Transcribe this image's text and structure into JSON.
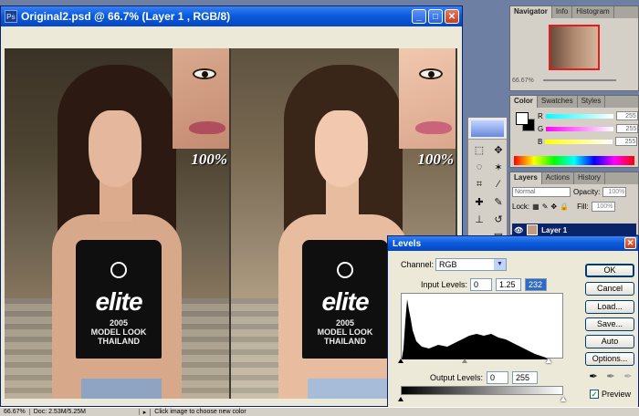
{
  "document": {
    "title": "Original2.psd @ 66.7% (Layer 1 , RGB/8)",
    "icon": "photoshop-doc-icon",
    "controls": [
      "minimize-icon",
      "maximize-icon",
      "close-icon"
    ],
    "photo_text": "elite",
    "photo_subtext": "2005\nMODEL LOOK\nTHAILAND",
    "zoom_inset_label": "100%"
  },
  "statusbar": {
    "zoom": "66.67%",
    "doc_size": "Doc: 2.53M/5.25M",
    "hint": "Click image to choose new color"
  },
  "navigator": {
    "tabs": [
      "Navigator",
      "Info",
      "Histogram"
    ],
    "zoom": "66.67%"
  },
  "color": {
    "tabs": [
      "Color",
      "Swatches",
      "Styles"
    ],
    "channels": [
      {
        "label": "R",
        "value": "255",
        "color": "#ff0000"
      },
      {
        "label": "G",
        "value": "255",
        "color": "#00c000"
      },
      {
        "label": "B",
        "value": "255",
        "color": "#0000ff"
      }
    ]
  },
  "layers": {
    "tabs": [
      "Layers",
      "Actions",
      "History"
    ],
    "blend_mode": "Normal",
    "opacity_label": "Opacity:",
    "opacity": "100%",
    "lock_label": "Lock:",
    "fill_label": "Fill:",
    "fill": "100%",
    "layer_name": "Layer 1"
  },
  "levels": {
    "title": "Levels",
    "channel_label": "Channel:",
    "channel": "RGB",
    "input_label": "Input Levels:",
    "input_black": "0",
    "input_gamma": "1.25",
    "input_white": "232",
    "output_label": "Output Levels:",
    "output_black": "0",
    "output_white": "255",
    "buttons": [
      "OK",
      "Cancel",
      "Load...",
      "Save...",
      "Auto",
      "Options..."
    ],
    "preview_label": "Preview",
    "preview_checked": true,
    "handles": {
      "black": 0,
      "gamma_pos": 0.43,
      "white": 232
    }
  }
}
